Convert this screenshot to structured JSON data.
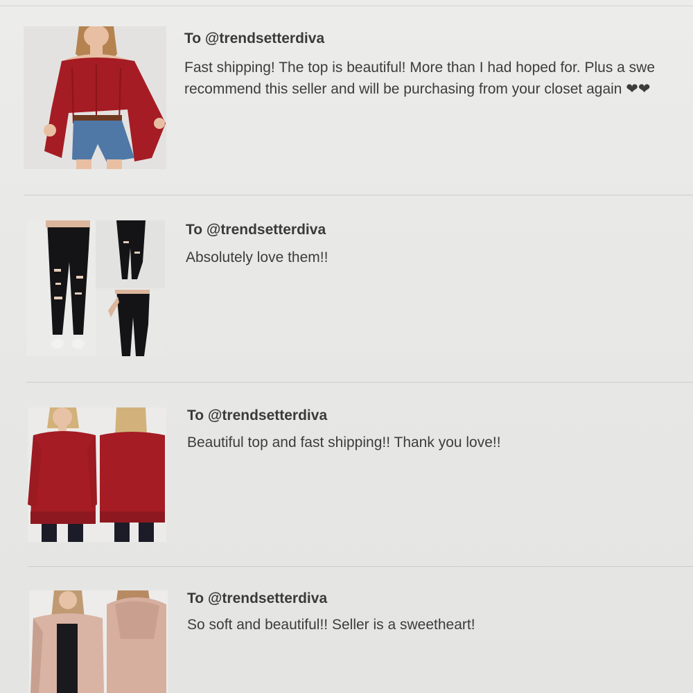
{
  "reviews": [
    {
      "recipient": "To @trendsetterdiva",
      "comment": "Fast shipping! The top is beautiful! More than I had hoped for. Plus a swe\nrecommend this seller and will be purchasing from your closet again ❤❤",
      "image_icon": "red-off-shoulder-top-photo"
    },
    {
      "recipient": "To @trendsetterdiva",
      "comment": "Absolutely love them!!",
      "image_icon": "black-ripped-jeans-photo"
    },
    {
      "recipient": "To @trendsetterdiva",
      "comment": "Beautiful top and fast shipping!! Thank you love!!",
      "image_icon": "red-ruffle-top-photo"
    },
    {
      "recipient": "To @trendsetterdiva",
      "comment": "So soft and beautiful!! Seller is a sweetheart!",
      "image_icon": "pink-hooded-cardigan-photo"
    }
  ],
  "colors": {
    "background": "#e8e8e6",
    "divider": "#cdcdcb",
    "text": "#3c3c3c",
    "red_garment": "#a51c24",
    "pink_garment": "#d9b3a3"
  }
}
